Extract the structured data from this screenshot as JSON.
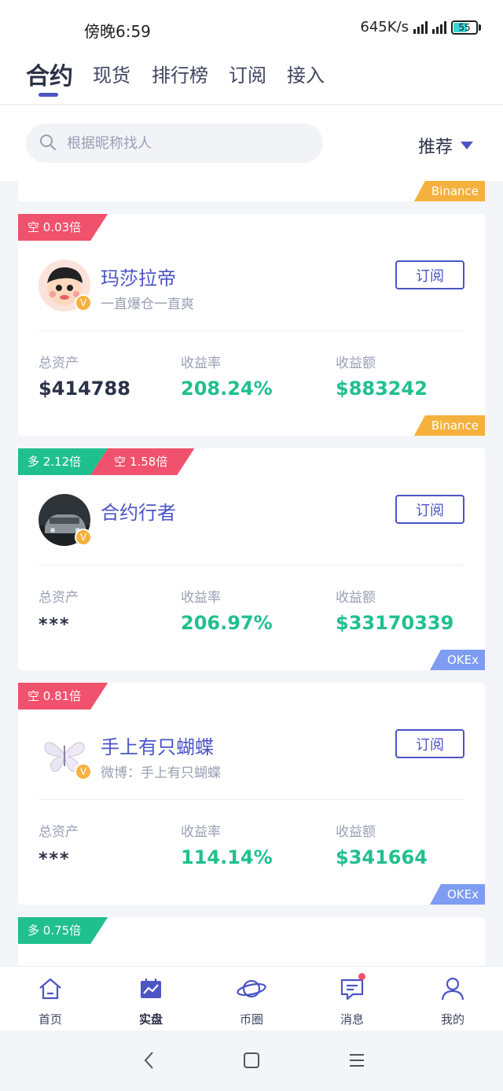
{
  "status_bar": {
    "time": "傍晚6:59",
    "net_speed": "645K/s",
    "battery": "55"
  },
  "tabs": [
    {
      "label": "合约",
      "active": true
    },
    {
      "label": "现货"
    },
    {
      "label": "排行榜"
    },
    {
      "label": "订阅"
    },
    {
      "label": "接入"
    }
  ],
  "search": {
    "placeholder": "根据昵称找人",
    "icon": "search-icon"
  },
  "sort": {
    "label": "推荐",
    "icon": "caret-down-icon"
  },
  "prev_card": {
    "exchange": "Binance"
  },
  "cards": [
    {
      "badges": [
        {
          "label": "空 0.03倍",
          "type": "short"
        }
      ],
      "name": "玛莎拉帝",
      "bio": "一直爆仓一直爽",
      "subscribe_label": "订阅",
      "stats": {
        "total_assets_label": "总资产",
        "total_assets": "$414788",
        "return_rate_label": "收益率",
        "return_rate": "208.24%",
        "profit_label": "收益额",
        "profit": "$883242"
      },
      "exchange": "Binance"
    },
    {
      "badges": [
        {
          "label": "多 2.12倍",
          "type": "long"
        },
        {
          "label": "空 1.58倍",
          "type": "short"
        }
      ],
      "name": "合约行者",
      "bio": "",
      "subscribe_label": "订阅",
      "stats": {
        "total_assets_label": "总资产",
        "total_assets": "***",
        "return_rate_label": "收益率",
        "return_rate": "206.97%",
        "profit_label": "收益额",
        "profit": "$33170339"
      },
      "exchange": "OKEx"
    },
    {
      "badges": [
        {
          "label": "空 0.81倍",
          "type": "short"
        }
      ],
      "name": "手上有只蝴蝶",
      "bio": "微博：手上有只蝴蝶",
      "subscribe_label": "订阅",
      "stats": {
        "total_assets_label": "总资产",
        "total_assets": "***",
        "return_rate_label": "收益率",
        "return_rate": "114.14%",
        "profit_label": "收益额",
        "profit": "$341664"
      },
      "exchange": "OKEx"
    },
    {
      "badges": [
        {
          "label": "多 0.75倍",
          "type": "long"
        }
      ]
    }
  ],
  "bottom_nav": [
    {
      "label": "首页",
      "icon": "home-icon"
    },
    {
      "label": "实盘",
      "icon": "chart-icon",
      "active": true
    },
    {
      "label": "币圈",
      "icon": "planet-icon"
    },
    {
      "label": "消息",
      "icon": "message-icon",
      "has_dot": true
    },
    {
      "label": "我的",
      "icon": "profile-icon"
    }
  ],
  "verified_mark": "V",
  "colors": {
    "accent": "#4b55c4",
    "green": "#20c08e",
    "red": "#f0516c",
    "binance": "#f5b13e",
    "okex": "#7d9cf2"
  }
}
